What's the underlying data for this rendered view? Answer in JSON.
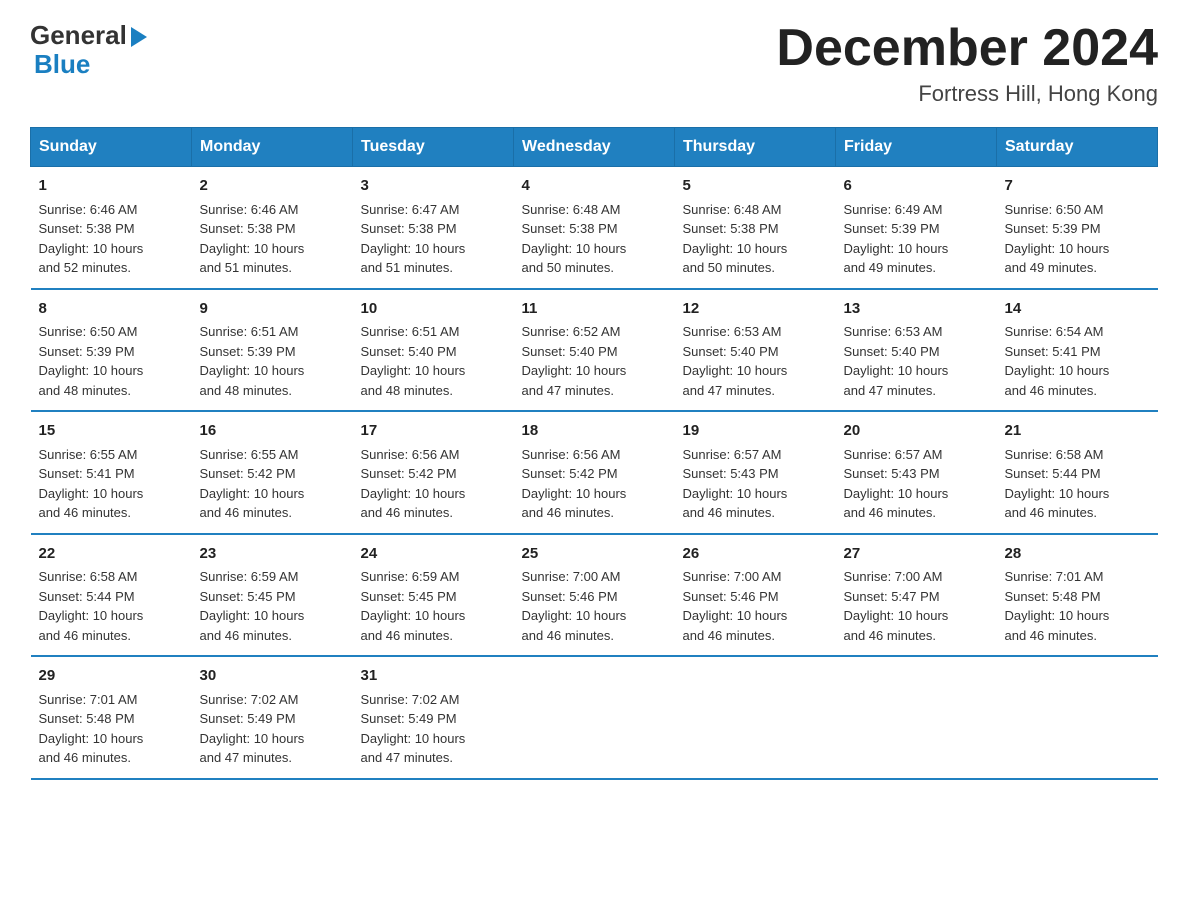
{
  "logo": {
    "general": "General",
    "blue": "Blue"
  },
  "title": "December 2024",
  "subtitle": "Fortress Hill, Hong Kong",
  "days_of_week": [
    "Sunday",
    "Monday",
    "Tuesday",
    "Wednesday",
    "Thursday",
    "Friday",
    "Saturday"
  ],
  "weeks": [
    [
      {
        "day": "1",
        "sunrise": "6:46 AM",
        "sunset": "5:38 PM",
        "daylight": "10 hours and 52 minutes."
      },
      {
        "day": "2",
        "sunrise": "6:46 AM",
        "sunset": "5:38 PM",
        "daylight": "10 hours and 51 minutes."
      },
      {
        "day": "3",
        "sunrise": "6:47 AM",
        "sunset": "5:38 PM",
        "daylight": "10 hours and 51 minutes."
      },
      {
        "day": "4",
        "sunrise": "6:48 AM",
        "sunset": "5:38 PM",
        "daylight": "10 hours and 50 minutes."
      },
      {
        "day": "5",
        "sunrise": "6:48 AM",
        "sunset": "5:38 PM",
        "daylight": "10 hours and 50 minutes."
      },
      {
        "day": "6",
        "sunrise": "6:49 AM",
        "sunset": "5:39 PM",
        "daylight": "10 hours and 49 minutes."
      },
      {
        "day": "7",
        "sunrise": "6:50 AM",
        "sunset": "5:39 PM",
        "daylight": "10 hours and 49 minutes."
      }
    ],
    [
      {
        "day": "8",
        "sunrise": "6:50 AM",
        "sunset": "5:39 PM",
        "daylight": "10 hours and 48 minutes."
      },
      {
        "day": "9",
        "sunrise": "6:51 AM",
        "sunset": "5:39 PM",
        "daylight": "10 hours and 48 minutes."
      },
      {
        "day": "10",
        "sunrise": "6:51 AM",
        "sunset": "5:40 PM",
        "daylight": "10 hours and 48 minutes."
      },
      {
        "day": "11",
        "sunrise": "6:52 AM",
        "sunset": "5:40 PM",
        "daylight": "10 hours and 47 minutes."
      },
      {
        "day": "12",
        "sunrise": "6:53 AM",
        "sunset": "5:40 PM",
        "daylight": "10 hours and 47 minutes."
      },
      {
        "day": "13",
        "sunrise": "6:53 AM",
        "sunset": "5:40 PM",
        "daylight": "10 hours and 47 minutes."
      },
      {
        "day": "14",
        "sunrise": "6:54 AM",
        "sunset": "5:41 PM",
        "daylight": "10 hours and 46 minutes."
      }
    ],
    [
      {
        "day": "15",
        "sunrise": "6:55 AM",
        "sunset": "5:41 PM",
        "daylight": "10 hours and 46 minutes."
      },
      {
        "day": "16",
        "sunrise": "6:55 AM",
        "sunset": "5:42 PM",
        "daylight": "10 hours and 46 minutes."
      },
      {
        "day": "17",
        "sunrise": "6:56 AM",
        "sunset": "5:42 PM",
        "daylight": "10 hours and 46 minutes."
      },
      {
        "day": "18",
        "sunrise": "6:56 AM",
        "sunset": "5:42 PM",
        "daylight": "10 hours and 46 minutes."
      },
      {
        "day": "19",
        "sunrise": "6:57 AM",
        "sunset": "5:43 PM",
        "daylight": "10 hours and 46 minutes."
      },
      {
        "day": "20",
        "sunrise": "6:57 AM",
        "sunset": "5:43 PM",
        "daylight": "10 hours and 46 minutes."
      },
      {
        "day": "21",
        "sunrise": "6:58 AM",
        "sunset": "5:44 PM",
        "daylight": "10 hours and 46 minutes."
      }
    ],
    [
      {
        "day": "22",
        "sunrise": "6:58 AM",
        "sunset": "5:44 PM",
        "daylight": "10 hours and 46 minutes."
      },
      {
        "day": "23",
        "sunrise": "6:59 AM",
        "sunset": "5:45 PM",
        "daylight": "10 hours and 46 minutes."
      },
      {
        "day": "24",
        "sunrise": "6:59 AM",
        "sunset": "5:45 PM",
        "daylight": "10 hours and 46 minutes."
      },
      {
        "day": "25",
        "sunrise": "7:00 AM",
        "sunset": "5:46 PM",
        "daylight": "10 hours and 46 minutes."
      },
      {
        "day": "26",
        "sunrise": "7:00 AM",
        "sunset": "5:46 PM",
        "daylight": "10 hours and 46 minutes."
      },
      {
        "day": "27",
        "sunrise": "7:00 AM",
        "sunset": "5:47 PM",
        "daylight": "10 hours and 46 minutes."
      },
      {
        "day": "28",
        "sunrise": "7:01 AM",
        "sunset": "5:48 PM",
        "daylight": "10 hours and 46 minutes."
      }
    ],
    [
      {
        "day": "29",
        "sunrise": "7:01 AM",
        "sunset": "5:48 PM",
        "daylight": "10 hours and 46 minutes."
      },
      {
        "day": "30",
        "sunrise": "7:02 AM",
        "sunset": "5:49 PM",
        "daylight": "10 hours and 47 minutes."
      },
      {
        "day": "31",
        "sunrise": "7:02 AM",
        "sunset": "5:49 PM",
        "daylight": "10 hours and 47 minutes."
      },
      null,
      null,
      null,
      null
    ]
  ],
  "labels": {
    "sunrise": "Sunrise:",
    "sunset": "Sunset:",
    "daylight": "Daylight: 10 hours"
  }
}
